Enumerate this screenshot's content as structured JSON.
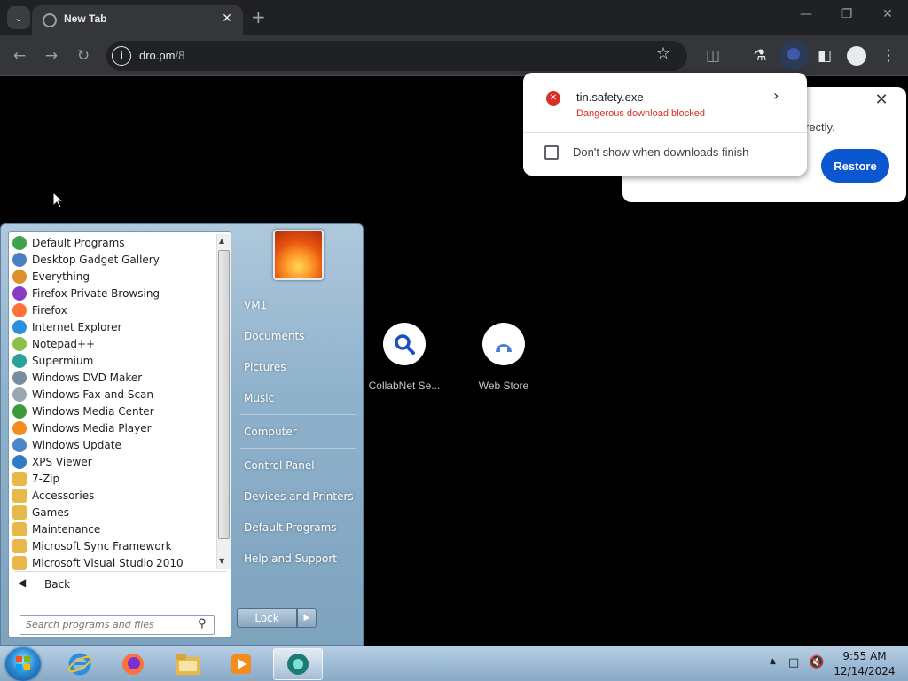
{
  "browser": {
    "tab_title": "New Tab",
    "url_host": "dro.pm",
    "url_path": "/8"
  },
  "download_bubble": {
    "file_name": "tin.safety.exe",
    "status": "Dangerous download blocked",
    "checkbox_label": "Don't show when downloads finish"
  },
  "restore_dialog": {
    "partial_text": "rectly.",
    "button_label": "Restore"
  },
  "shortcuts": [
    {
      "label": "CollabNet Se..."
    },
    {
      "label": "Web Store"
    }
  ],
  "start_menu": {
    "programs": [
      {
        "label": "Default Programs",
        "icon": "default-programs-icon",
        "color": "#3fa34d"
      },
      {
        "label": "Desktop Gadget Gallery",
        "icon": "gadget-icon",
        "color": "#4a7fc1"
      },
      {
        "label": "Everything",
        "icon": "everything-icon",
        "color": "#e0902a"
      },
      {
        "label": "Firefox Private Browsing",
        "icon": "firefox-private-icon",
        "color": "#8a3ac9"
      },
      {
        "label": "Firefox",
        "icon": "firefox-icon",
        "color": "#ff7139"
      },
      {
        "label": "Internet Explorer",
        "icon": "ie-icon",
        "color": "#2d8ee0"
      },
      {
        "label": "Notepad++",
        "icon": "notepad-icon",
        "color": "#8cbf4a"
      },
      {
        "label": "Supermium",
        "icon": "supermium-icon",
        "color": "#2aa198"
      },
      {
        "label": "Windows DVD Maker",
        "icon": "dvd-icon",
        "color": "#7a8d9e"
      },
      {
        "label": "Windows Fax and Scan",
        "icon": "fax-icon",
        "color": "#9aa7b3"
      },
      {
        "label": "Windows Media Center",
        "icon": "media-center-icon",
        "color": "#3c9a3c"
      },
      {
        "label": "Windows Media Player",
        "icon": "media-player-icon",
        "color": "#f28c1a"
      },
      {
        "label": "Windows Update",
        "icon": "update-icon",
        "color": "#4c86c6"
      },
      {
        "label": "XPS Viewer",
        "icon": "xps-icon",
        "color": "#2f7bc4"
      },
      {
        "label": "7-Zip",
        "icon": "folder-icon",
        "color": "#e7b84a"
      },
      {
        "label": "Accessories",
        "icon": "folder-icon",
        "color": "#e7b84a"
      },
      {
        "label": "Games",
        "icon": "folder-icon",
        "color": "#e7b84a"
      },
      {
        "label": "Maintenance",
        "icon": "folder-icon",
        "color": "#e7b84a"
      },
      {
        "label": "Microsoft Sync Framework",
        "icon": "folder-icon",
        "color": "#e7b84a"
      },
      {
        "label": "Microsoft Visual Studio 2010",
        "icon": "folder-icon",
        "color": "#e7b84a"
      }
    ],
    "back_label": "Back",
    "search_placeholder": "Search programs and files",
    "right_items": {
      "vm1": "VM1",
      "documents": "Documents",
      "pictures": "Pictures",
      "music": "Music",
      "computer": "Computer",
      "control_panel": "Control Panel",
      "devices_printers": "Devices and Printers",
      "default_programs": "Default Programs",
      "help_support": "Help and Support"
    },
    "lock_label": "Lock"
  },
  "taskbar": {
    "time": "9:55 AM",
    "date": "12/14/2024"
  }
}
